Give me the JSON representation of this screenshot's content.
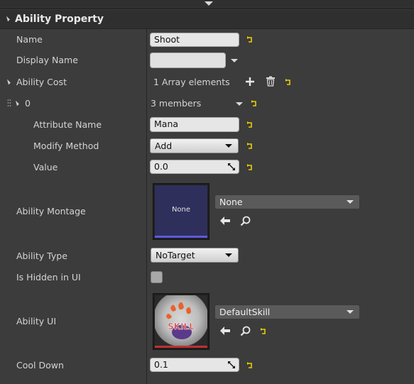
{
  "section": {
    "title": "Ability Property"
  },
  "rows": {
    "name": {
      "label": "Name",
      "value": "Shoot"
    },
    "display_name": {
      "label": "Display Name",
      "value": ""
    },
    "ability_cost": {
      "label": "Ability Cost",
      "summary": "1 Array elements"
    },
    "element_0": {
      "label": "0",
      "summary": "3 members"
    },
    "attribute_name": {
      "label": "Attribute Name",
      "value": "Mana"
    },
    "modify_method": {
      "label": "Modify Method",
      "value": "Add"
    },
    "value": {
      "label": "Value",
      "value": "0.0"
    },
    "ability_montage": {
      "label": "Ability Montage",
      "thumb_text": "None",
      "asset": "None"
    },
    "ability_type": {
      "label": "Ability Type",
      "value": "NoTarget"
    },
    "is_hidden": {
      "label": "Is Hidden in UI",
      "checked": false
    },
    "ability_ui": {
      "label": "Ability UI",
      "asset": "DefaultSkill",
      "thumb_text": "SKILL"
    },
    "cool_down": {
      "label": "Cool Down",
      "value": "0.1"
    }
  },
  "colors": {
    "panel_bg": "#3c3c3c",
    "reset_icon": "#e8d000",
    "montage_bar": "#5b5be0",
    "ui_bar": "#c03030"
  },
  "icons": {
    "reset": "reset-to-default-icon",
    "add": "plus-icon",
    "delete": "trash-icon",
    "browse": "arrow-left-icon",
    "find": "magnifier-icon"
  }
}
